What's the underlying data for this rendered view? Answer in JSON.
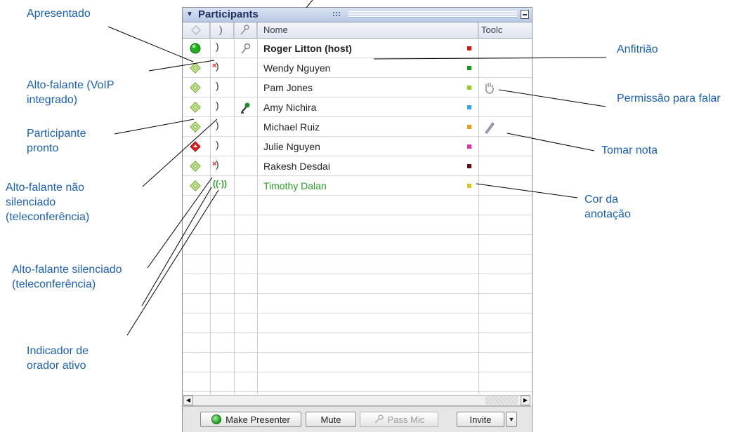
{
  "panel": {
    "title": "Participants",
    "columns": {
      "name": "Nome",
      "tools": "Toolc"
    }
  },
  "participants": [
    {
      "name": "Roger Litton (host)",
      "status": "presenter",
      "audio": "speaker",
      "mic": true,
      "color": "#e41010",
      "tool": ""
    },
    {
      "name": "Wendy Nguyen",
      "status": "ready",
      "audio": "speaker-muted",
      "mic": false,
      "color": "#10a010",
      "tool": ""
    },
    {
      "name": "Pam Jones",
      "status": "ready",
      "audio": "speaker",
      "mic": false,
      "color": "#8fd61a",
      "tool": "raise-hand"
    },
    {
      "name": "Amy Nichira",
      "status": "ready",
      "audio": "speaker",
      "mic": true,
      "color": "#35a6f0",
      "tool": ""
    },
    {
      "name": "Michael Ruiz",
      "status": "ready",
      "audio": "speaker",
      "mic": false,
      "color": "#f49a14",
      "tool": "note"
    },
    {
      "name": "Julie Nguyen",
      "status": "away",
      "audio": "speaker",
      "mic": false,
      "color": "#ee28a6",
      "tool": ""
    },
    {
      "name": "Rakesh Desdai",
      "status": "ready",
      "audio": "speaker-muted",
      "mic": false,
      "color": "#6a0a0a",
      "tool": ""
    },
    {
      "name": "Timothy Dalan",
      "status": "ready",
      "audio": "active-speaker",
      "mic": false,
      "color": "#d8cc18",
      "tool": ""
    }
  ],
  "footer": {
    "make_presenter": "Make Presenter",
    "mute": "Mute",
    "pass_mic": "Pass Mic",
    "invite": "Invite"
  },
  "annotations": {
    "presenter": "Apresentado",
    "voip_speaker": "Alto-falante (VoIP integrado)",
    "participant_ready": "Participante pronto",
    "speaker_unmuted": "Alto-falante não silenciado (teleconferência)",
    "speaker_muted": "Alto-falante silenciado (teleconferência)",
    "active_speaker": "Indicador de orador ativo",
    "host": "Anfitrião",
    "permission_to_speak": "Permissão para falar",
    "take_note": "Tomar nota",
    "annotation_color": "Cor da anotação"
  },
  "icons": {
    "presenter": "green-circle-icon",
    "ready": "green-diamond-icon",
    "away": "red-diamond-icon",
    "speaker": "speaker-icon",
    "speaker-muted": "muted-speaker-icon",
    "active-speaker": "active-speaker-icon",
    "mic": "microphone-icon",
    "raise-hand": "raise-hand-icon",
    "note": "pencil-icon"
  }
}
